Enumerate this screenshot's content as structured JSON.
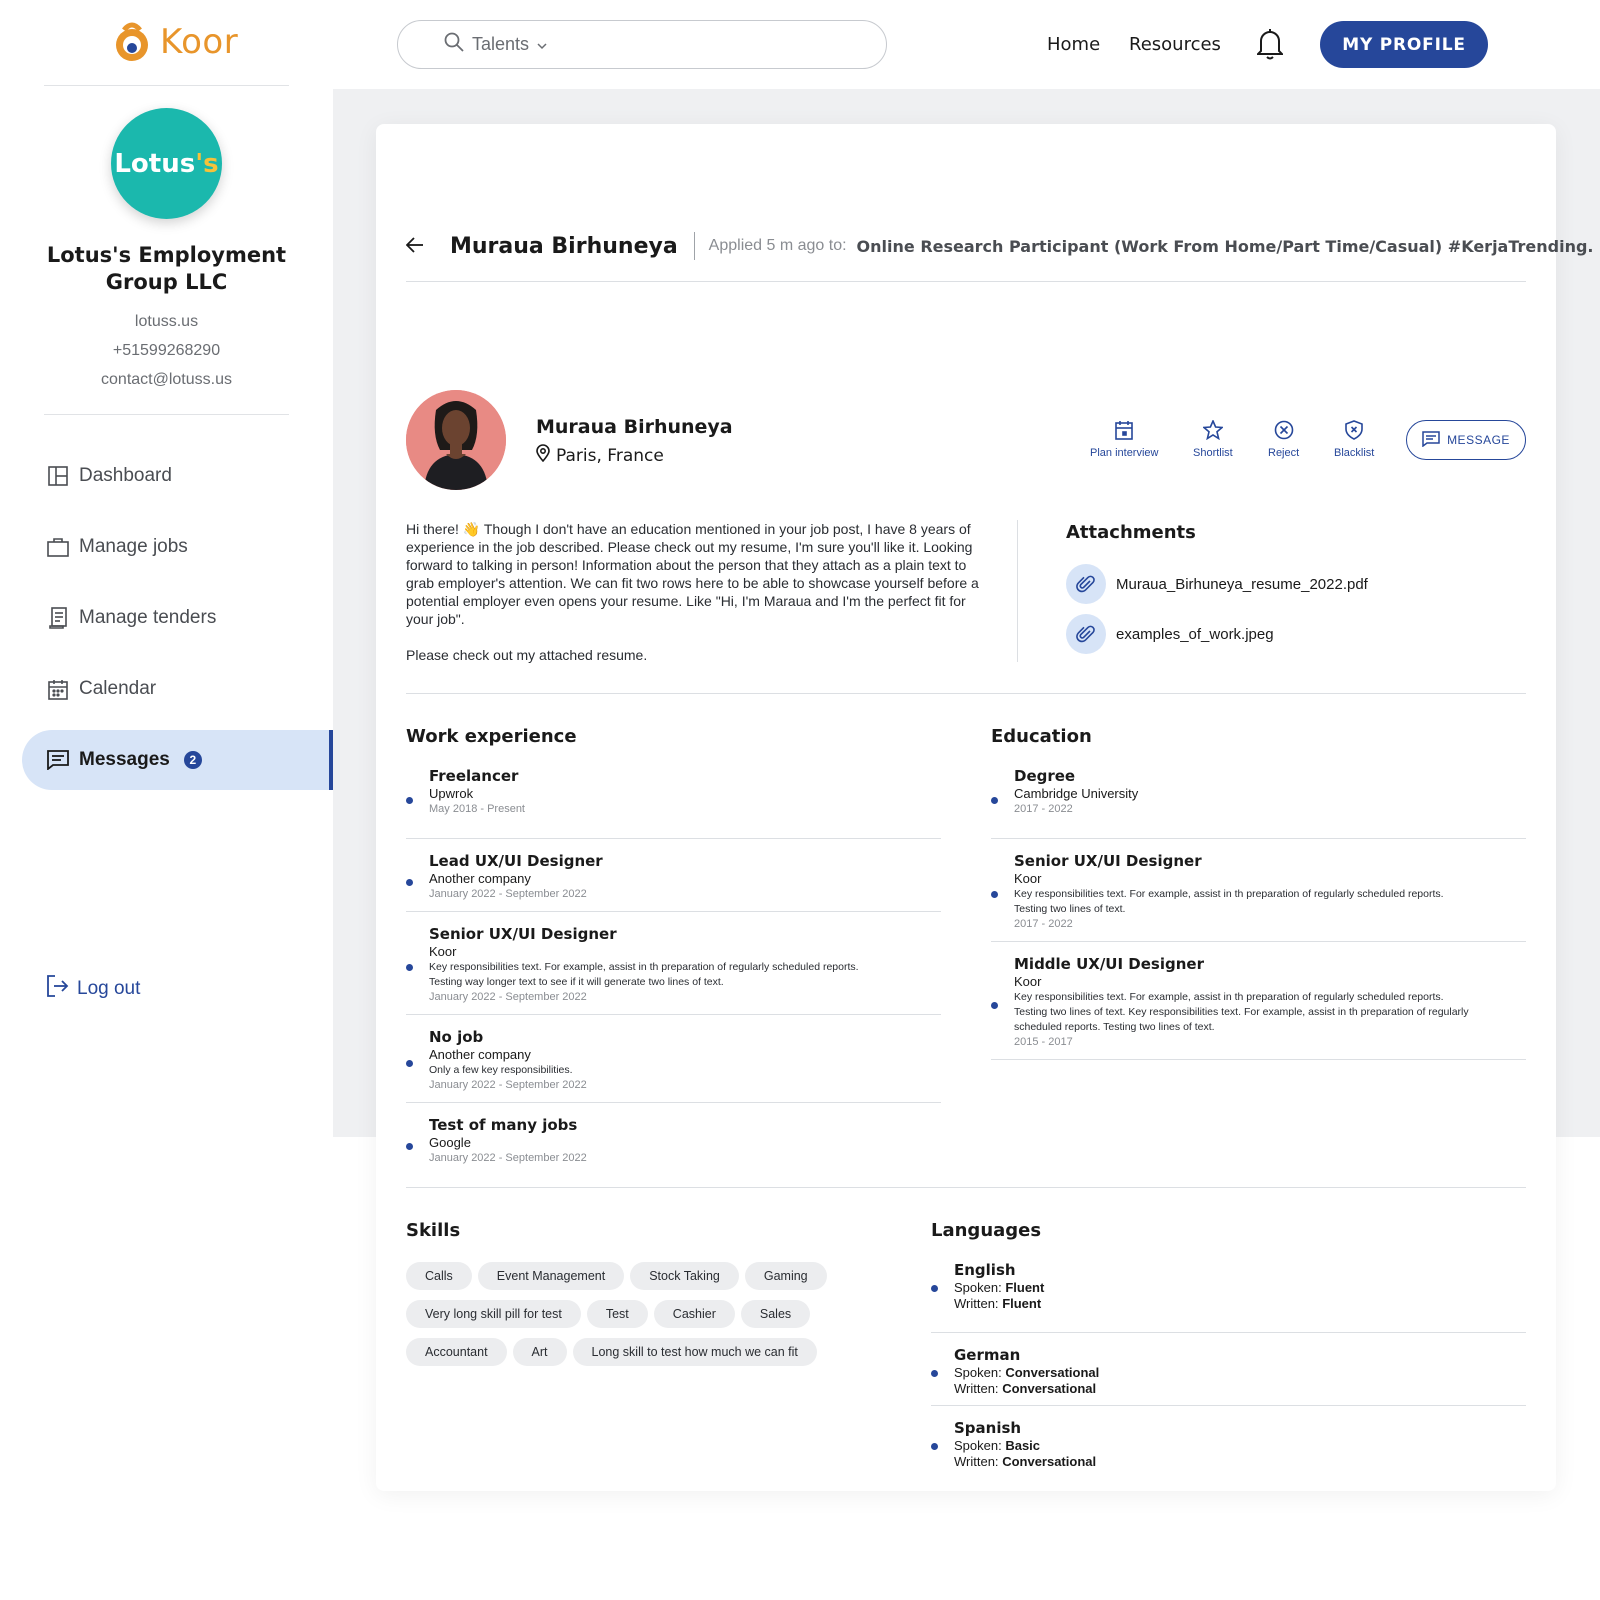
{
  "brand": {
    "name": "Koor"
  },
  "company": {
    "logo_text_main": "Lotus",
    "logo_text_accent": "'s",
    "name": "Lotus's Employment Group LLC",
    "website": "lotuss.us",
    "phone": "+51599268290",
    "email": "contact@lotuss.us"
  },
  "sidebar": {
    "items": [
      {
        "label": "Dashboard",
        "icon": "dashboard-icon"
      },
      {
        "label": "Manage jobs",
        "icon": "briefcase-icon"
      },
      {
        "label": "Manage tenders",
        "icon": "document-icon"
      },
      {
        "label": "Calendar",
        "icon": "calendar-icon"
      },
      {
        "label": "Messages",
        "icon": "message-icon",
        "badge": "2",
        "active": true
      }
    ],
    "logout": "Log out"
  },
  "topbar": {
    "search_category": "Talents",
    "home": "Home",
    "resources": "Resources",
    "profile_button": "MY PROFILE"
  },
  "application": {
    "candidate_name": "Muraua Birhuneya",
    "applied_text": "Applied 5 m ago to:",
    "job_title": "Online Research Participant (Work From Home/Part Time/Casual) #KerjaTrending."
  },
  "candidate": {
    "name": "Muraua Birhuneya",
    "location": "Paris, France",
    "intro_p1": "Hi there! 👋 Though I don't have an education mentioned in your job post, I have 8 years of experience in the job described. Please check out my resume, I'm sure you'll like it. Looking forward to talking in person! Information about the person that they attach as a plain text to grab employer's attention. We can fit two rows here to be able to showcase yourself before a potential employer even opens your resume. Like \"Hi, I'm Maraua and I'm the perfect fit for your job\".",
    "intro_p2": "Please check out my attached resume."
  },
  "actions": {
    "plan_interview": "Plan interview",
    "shortlist": "Shortlist",
    "reject": "Reject",
    "blacklist": "Blacklist",
    "message": "MESSAGE"
  },
  "attachments": {
    "title": "Attachments",
    "files": [
      "Muraua_Birhuneya_resume_2022.pdf",
      "examples_of_work.jpeg"
    ]
  },
  "work_experience": {
    "title": "Work experience",
    "items": [
      {
        "title": "Freelancer",
        "company": "Upwrok",
        "desc1": "",
        "desc2": "",
        "period": "May 2018 - Present"
      },
      {
        "title": "Lead UX/UI Designer",
        "company": "Another company",
        "desc1": "",
        "desc2": "",
        "period": "January 2022 - September 2022"
      },
      {
        "title": "Senior UX/UI Designer",
        "company": "Koor",
        "desc1": "Key responsibilities text. For example, assist in th preparation of regularly scheduled reports.",
        "desc2": "Testing way longer text to see if it will generate two lines of text.",
        "period": "January 2022 - September 2022"
      },
      {
        "title": "No job",
        "company": "Another company",
        "desc1": "Only a few key responsibilities.",
        "desc2": "",
        "period": "January 2022 - September 2022"
      },
      {
        "title": "Test of many jobs",
        "company": "Google",
        "desc1": "",
        "desc2": "",
        "period": "January 2022 - September 2022"
      }
    ]
  },
  "education": {
    "title": "Education",
    "items": [
      {
        "title": "Degree",
        "company": "Cambridge University",
        "desc1": "",
        "desc2": "",
        "desc3": "",
        "period": "2017 - 2022"
      },
      {
        "title": "Senior UX/UI Designer",
        "company": "Koor",
        "desc1": "Key responsibilities text. For example, assist in th preparation of regularly scheduled reports.",
        "desc2": "Testing two lines of text.",
        "desc3": "",
        "period": "2017 - 2022"
      },
      {
        "title": "Middle UX/UI Designer",
        "company": "Koor",
        "desc1": "Key responsibilities text. For example, assist in th preparation of regularly scheduled reports.",
        "desc2": "Testing two lines of text. Key responsibilities text. For example, assist in th preparation of regularly",
        "desc3": "scheduled reports. Testing two lines of text.",
        "period": "2015 - 2017"
      }
    ]
  },
  "skills": {
    "title": "Skills",
    "rows": [
      [
        "Calls",
        "Event Management",
        "Stock Taking",
        "Gaming"
      ],
      [
        "Very long skill pill for test",
        "Test",
        "Cashier",
        "Sales"
      ],
      [
        "Accountant",
        "Art",
        "Long skill to test how much we can fit"
      ]
    ]
  },
  "languages": {
    "title": "Languages",
    "spoken_label": "Spoken:",
    "written_label": "Written:",
    "items": [
      {
        "name": "English",
        "spoken": "Fluent",
        "written": "Fluent"
      },
      {
        "name": "German",
        "spoken": "Conversational",
        "written": "Conversational"
      },
      {
        "name": "Spanish",
        "spoken": "Basic",
        "written": "Conversational"
      }
    ]
  },
  "colors": {
    "accent": "#26479a",
    "active_bg": "#d7e4f7",
    "brand_orange": "#e8952b",
    "company_teal": "#1bb8ad"
  }
}
